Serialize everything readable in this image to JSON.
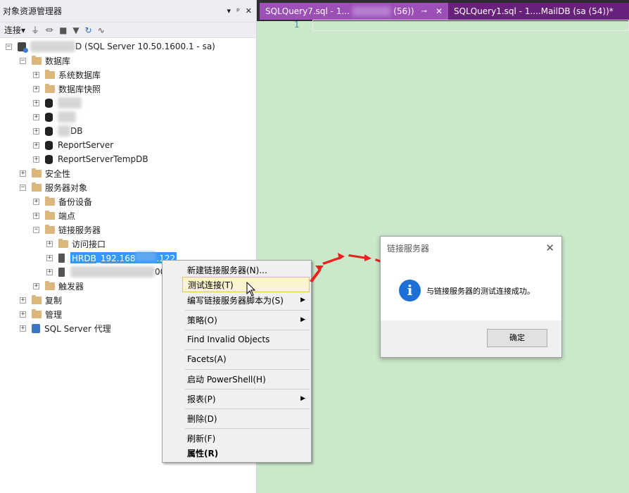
{
  "object_explorer": {
    "title": "对象资源管理器",
    "title_buttons": [
      "▾",
      "ᵖ",
      "✕"
    ],
    "toolbar": {
      "connect_label": "连接",
      "connect_arrow": "▾"
    }
  },
  "tree": {
    "server_label": "D (SQL Server 10.50.1600.1 - sa)",
    "databases_label": "数据库",
    "system_db_label": "系统数据库",
    "db_snapshot_label": "数据库快照",
    "db3_label": "DB",
    "report_server_label": "ReportServer",
    "report_temp_label": "ReportServerTempDB",
    "security_label": "安全性",
    "server_objects_label": "服务器对象",
    "backup_devices_label": "备份设备",
    "endpoints_label": "端点",
    "linked_servers_label": "链接服务器",
    "providers_label": "访问接口",
    "hrdb_prefix": "HRDB_192.168",
    "hrdb_suffix": ".122",
    "second_linked_suffix": "000",
    "triggers_label": "触发器",
    "replication_label": "复制",
    "management_label": "管理",
    "agent_label": "SQL Server 代理"
  },
  "tabs": {
    "tab1_prefix": "SQLQuery7.sql - 1...",
    "tab1_suffix": "(56))",
    "tab1_pin": "⊸",
    "tab1_close": "✕",
    "tab2_label": "SQLQuery1.sql - 1....MailDB (sa (54))*"
  },
  "editor": {
    "line_number": "1"
  },
  "context_menu": {
    "new_linked": "新建链接服务器(N)...",
    "test_connection": "测试连接(T)",
    "script_as": "编写链接服务器脚本为(S)",
    "policies": "策略(O)",
    "find_invalid": "Find Invalid Objects",
    "facets": "Facets(A)",
    "powershell": "启动 PowerShell(H)",
    "reports": "报表(P)",
    "delete": "删除(D)",
    "refresh": "刷新(F)",
    "properties": "属性(R)"
  },
  "dialog": {
    "title": "链接服务器",
    "close": "✕",
    "info_glyph": "i",
    "message": "与链接服务器的测试连接成功。",
    "ok_label": "确定"
  },
  "colors": {
    "editor_bg": "#cbe8cb",
    "tab_active": "#9b4fb7",
    "tab_inactive": "#68217a",
    "selection": "#3399ff",
    "arrow": "#f02020"
  }
}
